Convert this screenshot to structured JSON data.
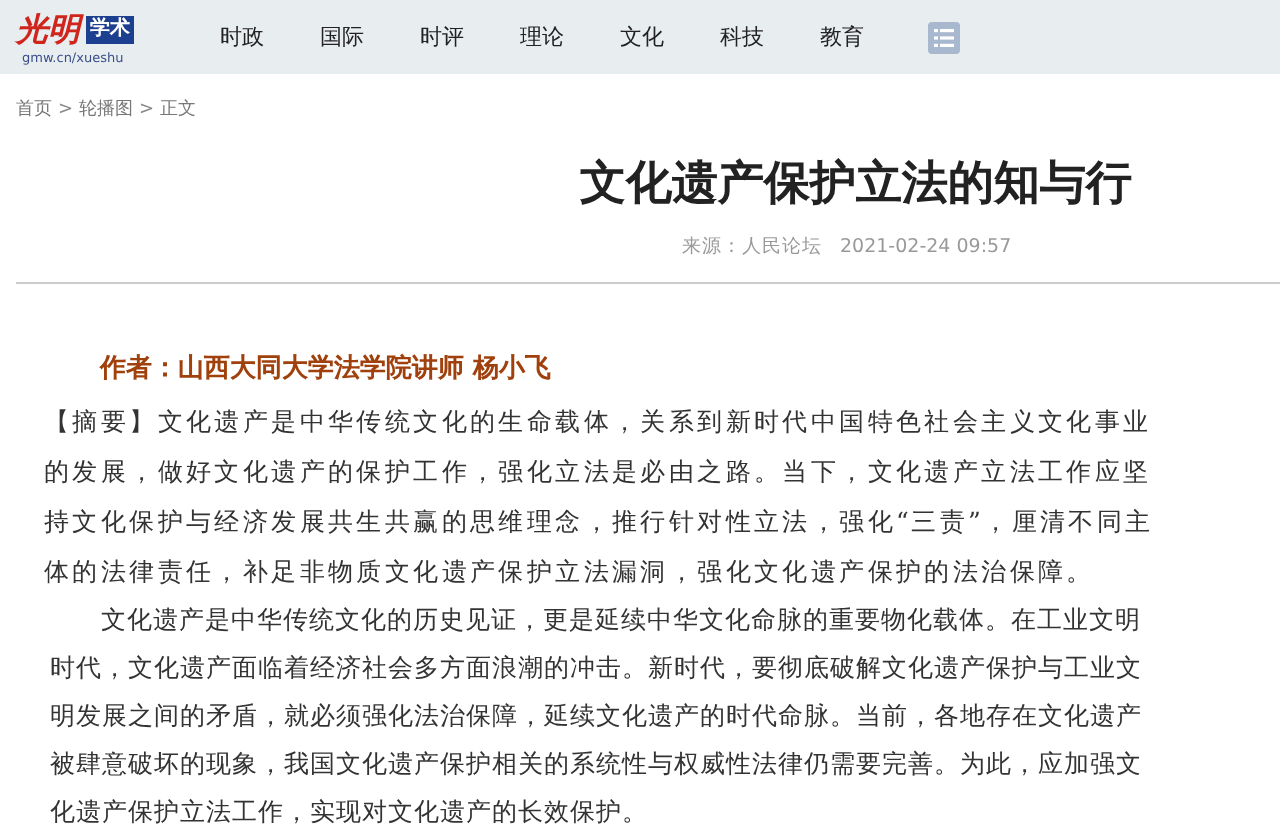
{
  "header": {
    "logo": {
      "mark": "光明",
      "badge": "学术",
      "url": "gmw.cn/xueshu"
    },
    "nav": [
      {
        "label": "时政"
      },
      {
        "label": "国际"
      },
      {
        "label": "时评"
      },
      {
        "label": "理论"
      },
      {
        "label": "文化"
      },
      {
        "label": "科技"
      },
      {
        "label": "教育"
      }
    ]
  },
  "breadcrumb": [
    {
      "label": "首页",
      "kind": "link"
    },
    {
      "label": ">",
      "kind": "sep"
    },
    {
      "label": "轮播图",
      "kind": "link"
    },
    {
      "label": ">",
      "kind": "sep"
    },
    {
      "label": "正文",
      "kind": "text"
    }
  ],
  "article": {
    "title": "文化遗产保护立法的知与行",
    "source": "来源：人民论坛",
    "date": "2021-02-24 09:57",
    "author": "作者：山西大同大学法学院讲师 杨小飞",
    "abstract": "【摘要】文化遗产是中华传统文化的生命载体，关系到新时代中国特色社会主义文化事业的发展，做好文化遗产的保护工作，强化立法是必由之路。当下，文化遗产立法工作应坚持文化保护与经济发展共生共赢的思维理念，推行针对性立法，强化“三责”，厘清不同主体的法律责任，补足非物质文化遗产保护立法漏洞，强化文化遗产保护的法治保障。",
    "paragraphs": [
      "文化遗产是中华传统文化的历史见证，更是延续中华文化命脉的重要物化载体。在工业文明时代，文化遗产面临着经济社会多方面浪潮的冲击。新时代，要彻底破解文化遗产保护与工业文明发展之间的矛盾，就必须强化法治保障，延续文化遗产的时代命脉。当前，各地存在文化遗产被肆意破坏的现象，我国文化遗产保护相关的系统性与权威性法律仍需要完善。为此，应加强文化遗产保护立法工作，实现对文化遗产的长效保护。"
    ]
  }
}
